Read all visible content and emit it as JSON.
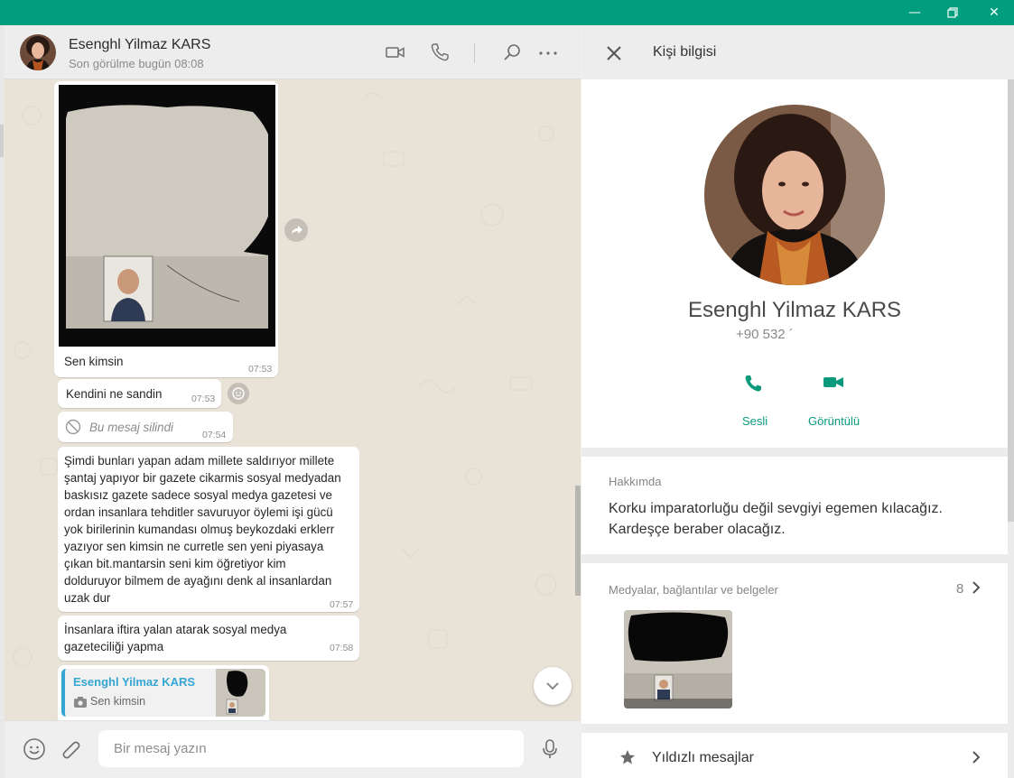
{
  "chat": {
    "contact_name": "Esenghl Yilmaz KARS",
    "status": "Son görülme bugün 08:08",
    "messages": [
      {
        "text": "Sen kimsin",
        "time": "07:53"
      },
      {
        "text": "Kendini ne sandin",
        "time": "07:53"
      },
      {
        "text": "Bu mesaj silindi",
        "time": "07:54"
      },
      {
        "text": "Şimdi bunları yapan adam millete saldırıyor millete şantaj yapıyor bir gazete cikarmis sosyal medyadan baskısız gazete sadece sosyal medya gazetesi ve ordan insanlara tehditler savuruyor öylemi işi gücü yok birilerinin kumandası olmuş beykozdaki erklerr yazıyor sen kimsin ne curretle sen yeni piyasaya çıkan bit.mantarsin seni kim öğretiyor kim dolduruyor bilmem de ayağını denk al insanlardan uzak dur",
        "time": "07:57"
      },
      {
        "text": "İnsanlara iftira yalan atarak sosyal medya gazeteciliği yapma",
        "time": "07:58"
      }
    ],
    "message_lines": {
      "long": [
        "Şimdi bunları yapan adam millete saldırıyor millete",
        "şantaj yapıyor bir gazete cikarmis sosyal medyadan",
        "baskısız gazete sadece sosyal medya gazetesi ve",
        "ordan insanlara tehditler savuruyor öylemi işi gücü",
        "yok birilerinin kumandası olmuş beykozdaki erklerr",
        "yazıyor sen kimsin ne curretle sen yeni piyasaya",
        "çıkan bit.mantarsin seni kim öğretiyor kim",
        "dolduruyor bilmem de ayağını denk al insanlardan",
        "uzak dur"
      ],
      "last": [
        "İnsanlara iftira yalan atarak sosyal medya",
        "gazeteciliği yapma"
      ]
    },
    "reply_preview": {
      "name": "Esenghl Yilmaz KARS",
      "text": "Sen kimsin"
    },
    "composer_placeholder": "Bir mesaj yazın"
  },
  "info": {
    "title": "Kişi bilgisi",
    "name": "Esenghl Yilmaz KARS",
    "phone": "+90 532 ´",
    "actions": {
      "voice": "Sesli",
      "video": "Görüntülü"
    },
    "about_label": "Hakkımda",
    "about_lines": [
      "Korku imparatorluğu değil sevgiyi egemen kılacağız.",
      "Kardeşçe beraber olacağız."
    ],
    "media_label": "Medyalar, bağlantılar ve belgeler",
    "media_count": "8",
    "starred_label": "Yıldızlı mesajlar"
  },
  "colors": {
    "accent": "#009e7e",
    "bubble": "#ffffff",
    "chat_bg": "#e8e2d7",
    "reply_name": "#35a6d4"
  }
}
